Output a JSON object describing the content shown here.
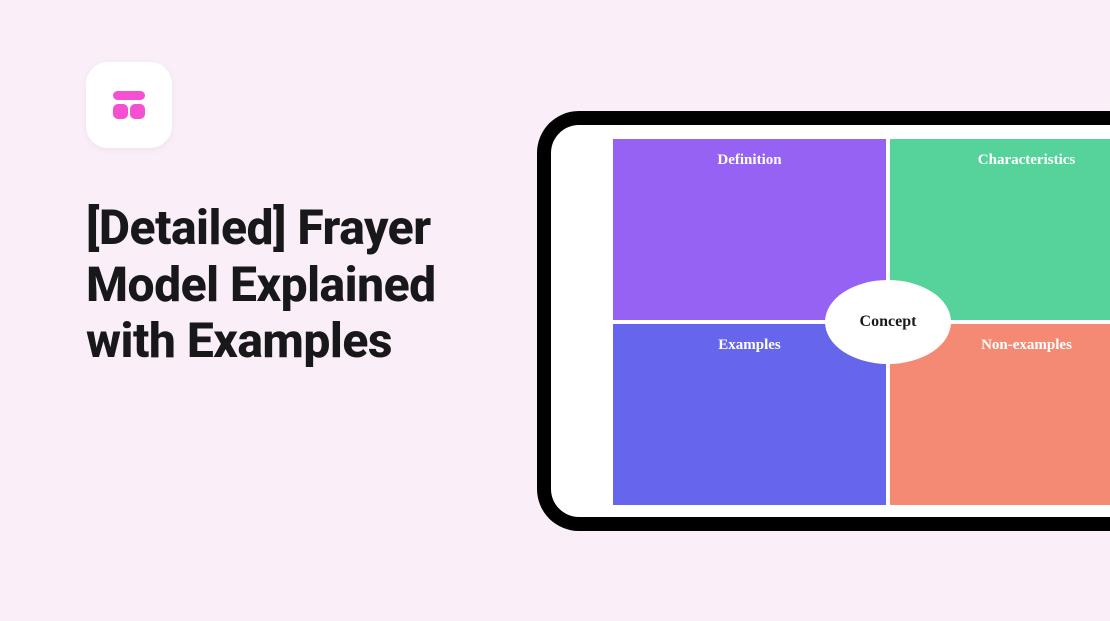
{
  "heading": "[Detailed] Frayer Model Explained with Examples",
  "frayer": {
    "center": "Concept",
    "quadrants": {
      "definition": "Definition",
      "characteristics": "Characteristics",
      "examples": "Examples",
      "nonexamples": "Non-examples"
    }
  },
  "colors": {
    "background": "#faeff9",
    "accent": "#f54fd2",
    "definition": "#9662f3",
    "characteristics": "#56d39b",
    "examples": "#6666ed",
    "nonexamples": "#f58a74"
  }
}
